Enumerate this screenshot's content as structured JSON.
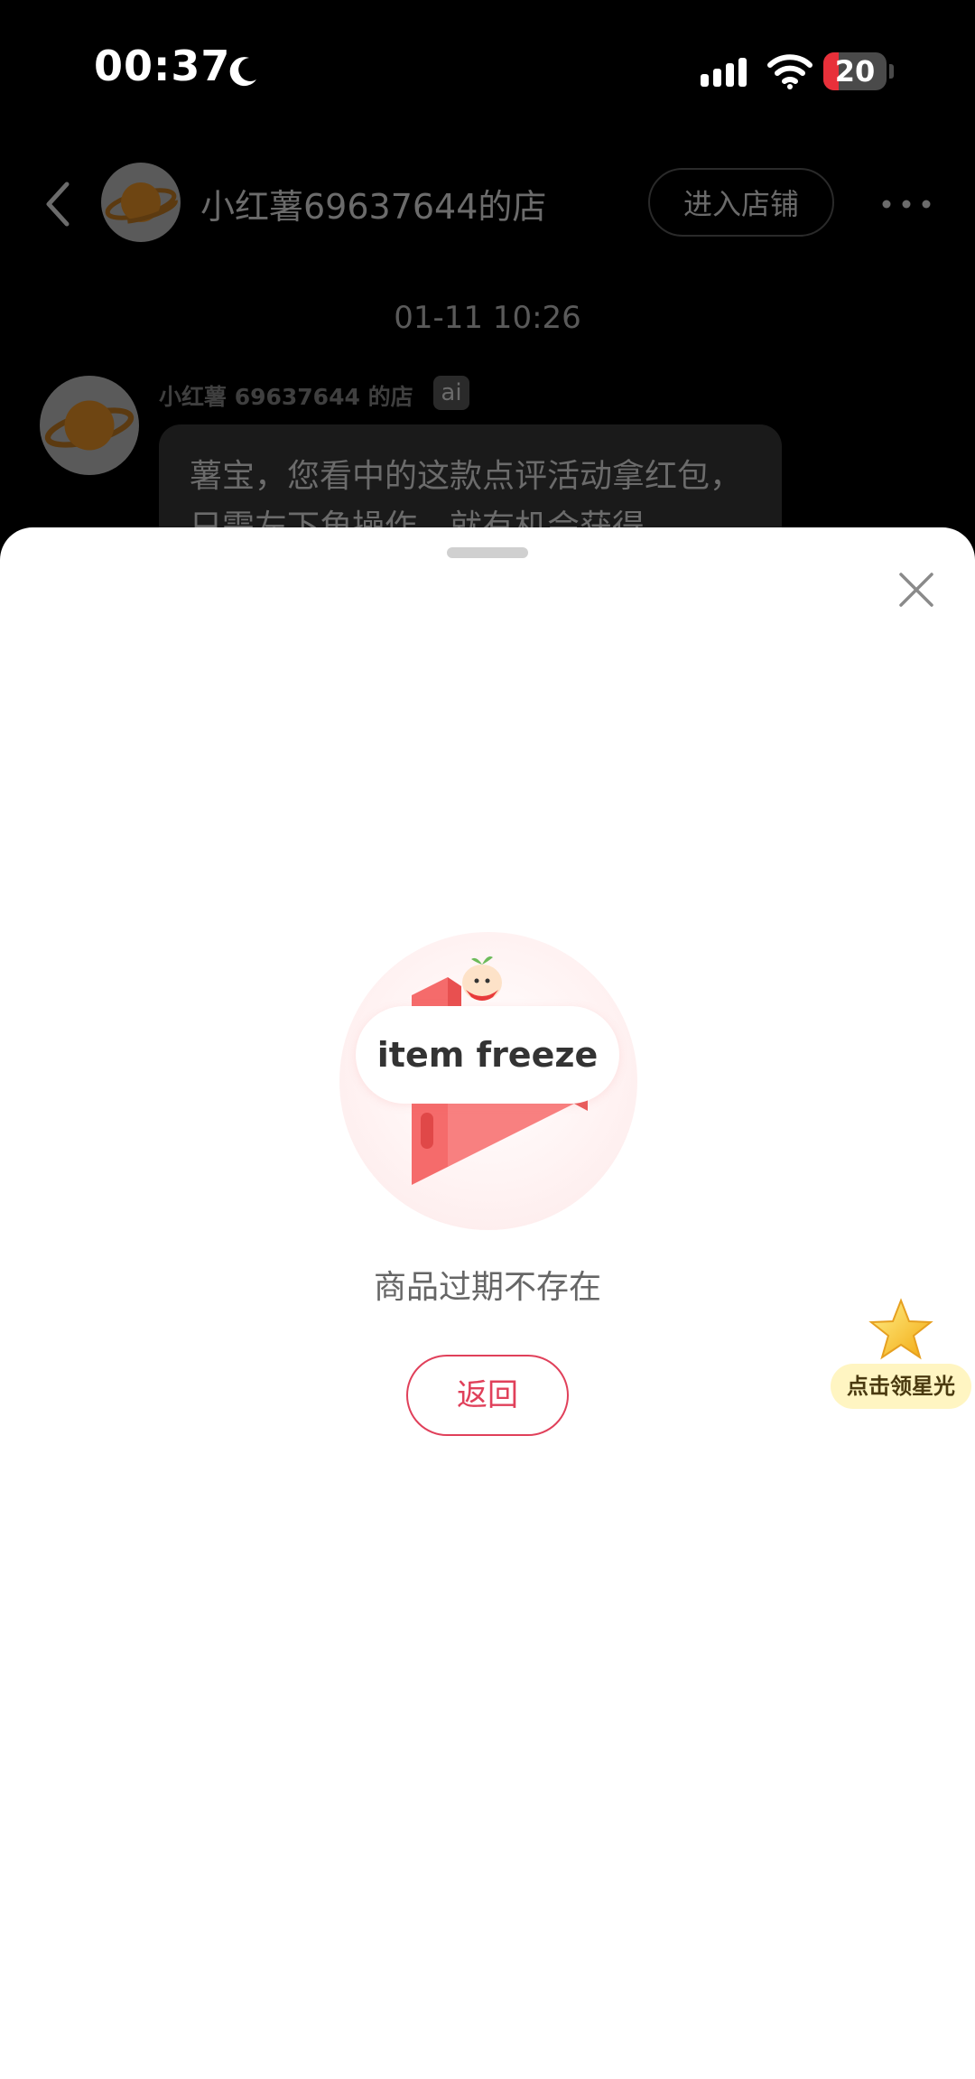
{
  "status_bar": {
    "time": "00:37",
    "battery": "20",
    "moon_icon": "moon-icon",
    "signal_icon": "cellular-signal-icon",
    "wifi_icon": "wifi-icon"
  },
  "chat_header": {
    "shop_name": "小红薯69637644的店",
    "enter_shop_label": "进入店铺",
    "back_icon": "chevron-left-icon",
    "more_icon": "more-dots-icon"
  },
  "chat": {
    "timestamp": "01-11 10:26",
    "sender": "小红薯 69637644 的店",
    "ai_badge": "ai",
    "message": "薯宝，您看中的这款点评活动拿红包，只需左下角操作，就有机会获得"
  },
  "sheet": {
    "freeze_label": "item freeze",
    "error_message": "商品过期不存在",
    "return_label": "返回",
    "close_icon": "close-icon"
  },
  "star_widget": {
    "label": "点击领星光",
    "icon": "star-icon"
  },
  "colors": {
    "accent": "#e0405a",
    "background_overlay": "#000000",
    "star_bg": "#fff5c2"
  }
}
